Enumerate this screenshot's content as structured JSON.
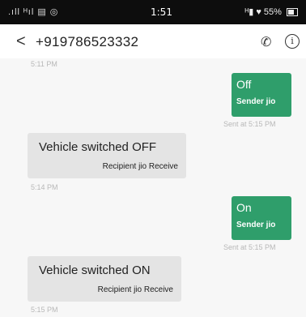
{
  "status_bar": {
    "signal_text": ".ıll ᴴıl ▤ ◎",
    "time": "1:51",
    "right_text": "ᴴ▮ ♥ 55%",
    "battery_percent": 55
  },
  "header": {
    "back_glyph": "<",
    "phone_number": "+919786523332",
    "call_icon_glyph": "✆",
    "info_icon_glyph": "i"
  },
  "messages": [
    {
      "kind": "timestamp",
      "text": "5:11 PM"
    },
    {
      "kind": "sent",
      "text": "Off",
      "sim_label": "Sender jio",
      "meta": "Sent at 5:15 PM"
    },
    {
      "kind": "received",
      "text": "Vehicle switched OFF",
      "sim_label": "Recipient jio Receive",
      "meta": "5:14 PM"
    },
    {
      "kind": "sent",
      "text": "On",
      "sim_label": "Sender jio",
      "meta": "Sent at 5:15 PM"
    },
    {
      "kind": "received",
      "text": "Vehicle switched ON",
      "sim_label": "Recipient jio Receive",
      "meta": "5:15 PM"
    }
  ],
  "colors": {
    "sent_bubble": "#2f9e6b",
    "received_bubble": "#e4e4e4",
    "chat_background": "#f7f7f7",
    "status_bar": "#0d0d0d"
  }
}
